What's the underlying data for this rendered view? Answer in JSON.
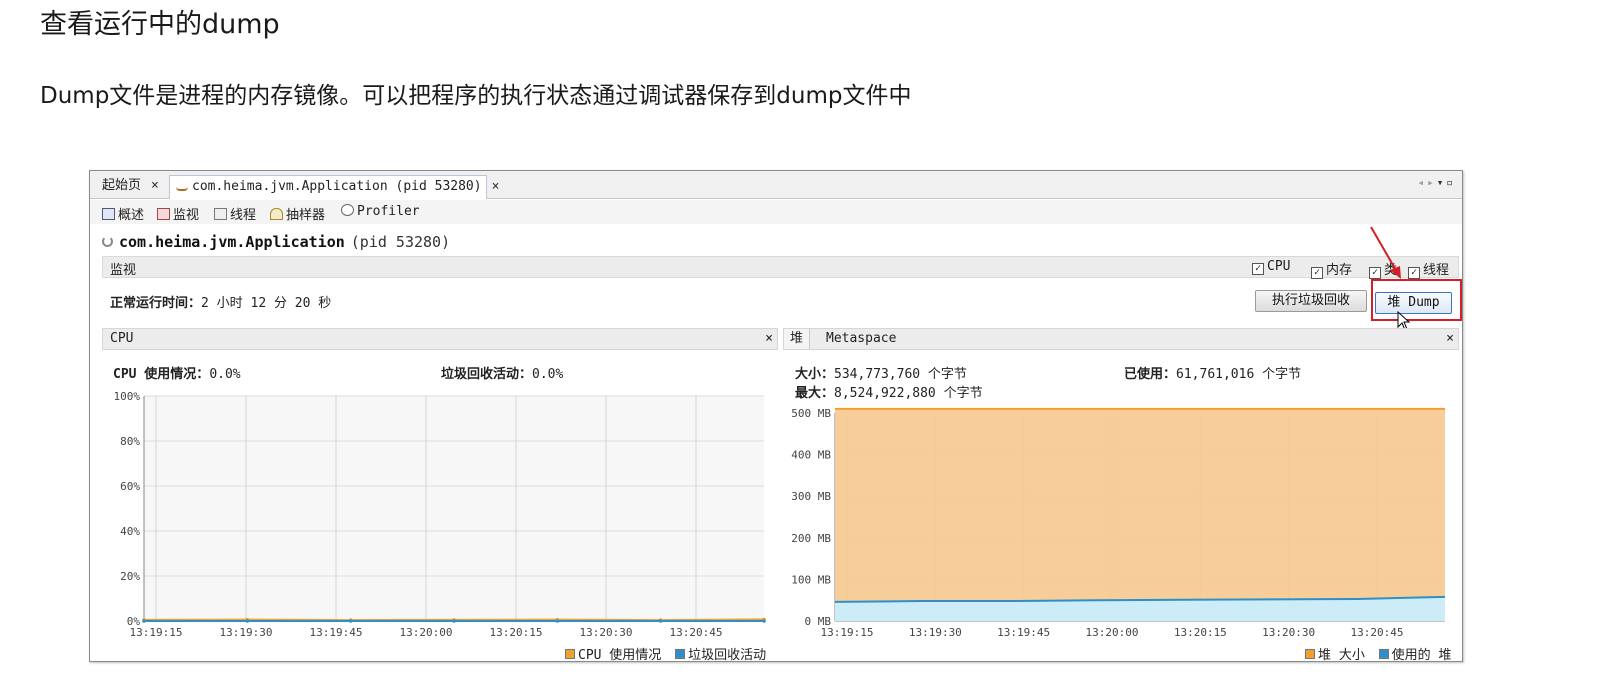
{
  "doc": {
    "title": "查看运行中的dump",
    "paragraph": "Dump文件是进程的内存镜像。可以把程序的执行状态通过调试器保存到dump文件中"
  },
  "tabs": {
    "start_label": "起始页",
    "app_label": "com.heima.jvm.Application (pid 53280)",
    "close_glyph": "×"
  },
  "subtabs": [
    {
      "label": "概述",
      "icon": "overview-icon"
    },
    {
      "label": "监视",
      "icon": "monitor-icon"
    },
    {
      "label": "线程",
      "icon": "threads-icon"
    },
    {
      "label": "抽样器",
      "icon": "sampler-icon"
    },
    {
      "label": "Profiler",
      "icon": "profiler-icon"
    }
  ],
  "process": {
    "name": "com.heima.jvm.Application",
    "pid": "(pid 53280)"
  },
  "monitor": {
    "title": "监视",
    "checkboxes": [
      {
        "label": "CPU",
        "checked": true
      },
      {
        "label": "内存",
        "checked": true
      },
      {
        "label": "类",
        "checked": true
      },
      {
        "label": "线程",
        "checked": true
      }
    ],
    "uptime_label": "正常运行时间：",
    "uptime_value": "2 小时 12 分 20 秒",
    "gc_button": "执行垃圾回收",
    "dump_button": "堆 Dump"
  },
  "cpu_panel": {
    "title": "CPU",
    "usage_label": "CPU 使用情况：",
    "usage_value": "0.0%",
    "gc_label": "垃圾回收活动：",
    "gc_value": "0.0%",
    "legend": [
      {
        "label": "CPU 使用情况",
        "color": "#f0a030"
      },
      {
        "label": "垃圾回收活动",
        "color": "#2f8fc8"
      }
    ]
  },
  "heap_panel": {
    "tab_heap": "堆",
    "tab_meta": "Metaspace",
    "size_label": "大小：",
    "size_value": "534,773,760 个字节",
    "max_label": "最大：",
    "max_value": "8,524,922,880 个字节",
    "used_label": "已使用：",
    "used_value": "61,761,016 个字节",
    "legend": [
      {
        "label": "堆 大小",
        "color": "#f0a030"
      },
      {
        "label": "使用的 堆",
        "color": "#2f8fc8"
      }
    ]
  },
  "chart_data": [
    {
      "type": "line",
      "x": [
        "13:19:15",
        "13:19:30",
        "13:19:45",
        "13:20:00",
        "13:20:15",
        "13:20:30",
        "13:20:45"
      ],
      "yticks": [
        "100%",
        "80%",
        "60%",
        "40%",
        "20%",
        "0%"
      ],
      "ylim": [
        0,
        100
      ],
      "series": [
        {
          "name": "CPU 使用情况",
          "color": "#f0a030",
          "values": [
            0.5,
            0.6,
            0.4,
            0.5,
            0.6,
            0.4,
            0.7
          ]
        },
        {
          "name": "垃圾回收活动",
          "color": "#2f8fc8",
          "values": [
            0,
            0,
            0,
            0,
            0,
            0,
            0
          ]
        }
      ],
      "grid": true
    },
    {
      "type": "area",
      "x": [
        "13:19:15",
        "13:19:30",
        "13:19:45",
        "13:20:00",
        "13:20:15",
        "13:20:30",
        "13:20:45"
      ],
      "yticks": [
        "500 MB",
        "400 MB",
        "300 MB",
        "200 MB",
        "100 MB",
        "0 MB"
      ],
      "ylim": [
        0,
        500
      ],
      "series": [
        {
          "name": "堆 大小",
          "color": "#f0a030",
          "values": [
            510,
            510,
            510,
            510,
            510,
            510,
            510,
            510
          ]
        },
        {
          "name": "使用的 堆",
          "color": "#2f8fc8",
          "values": [
            46,
            48,
            48,
            50,
            51,
            52,
            53,
            58
          ]
        }
      ],
      "grid": true
    }
  ]
}
